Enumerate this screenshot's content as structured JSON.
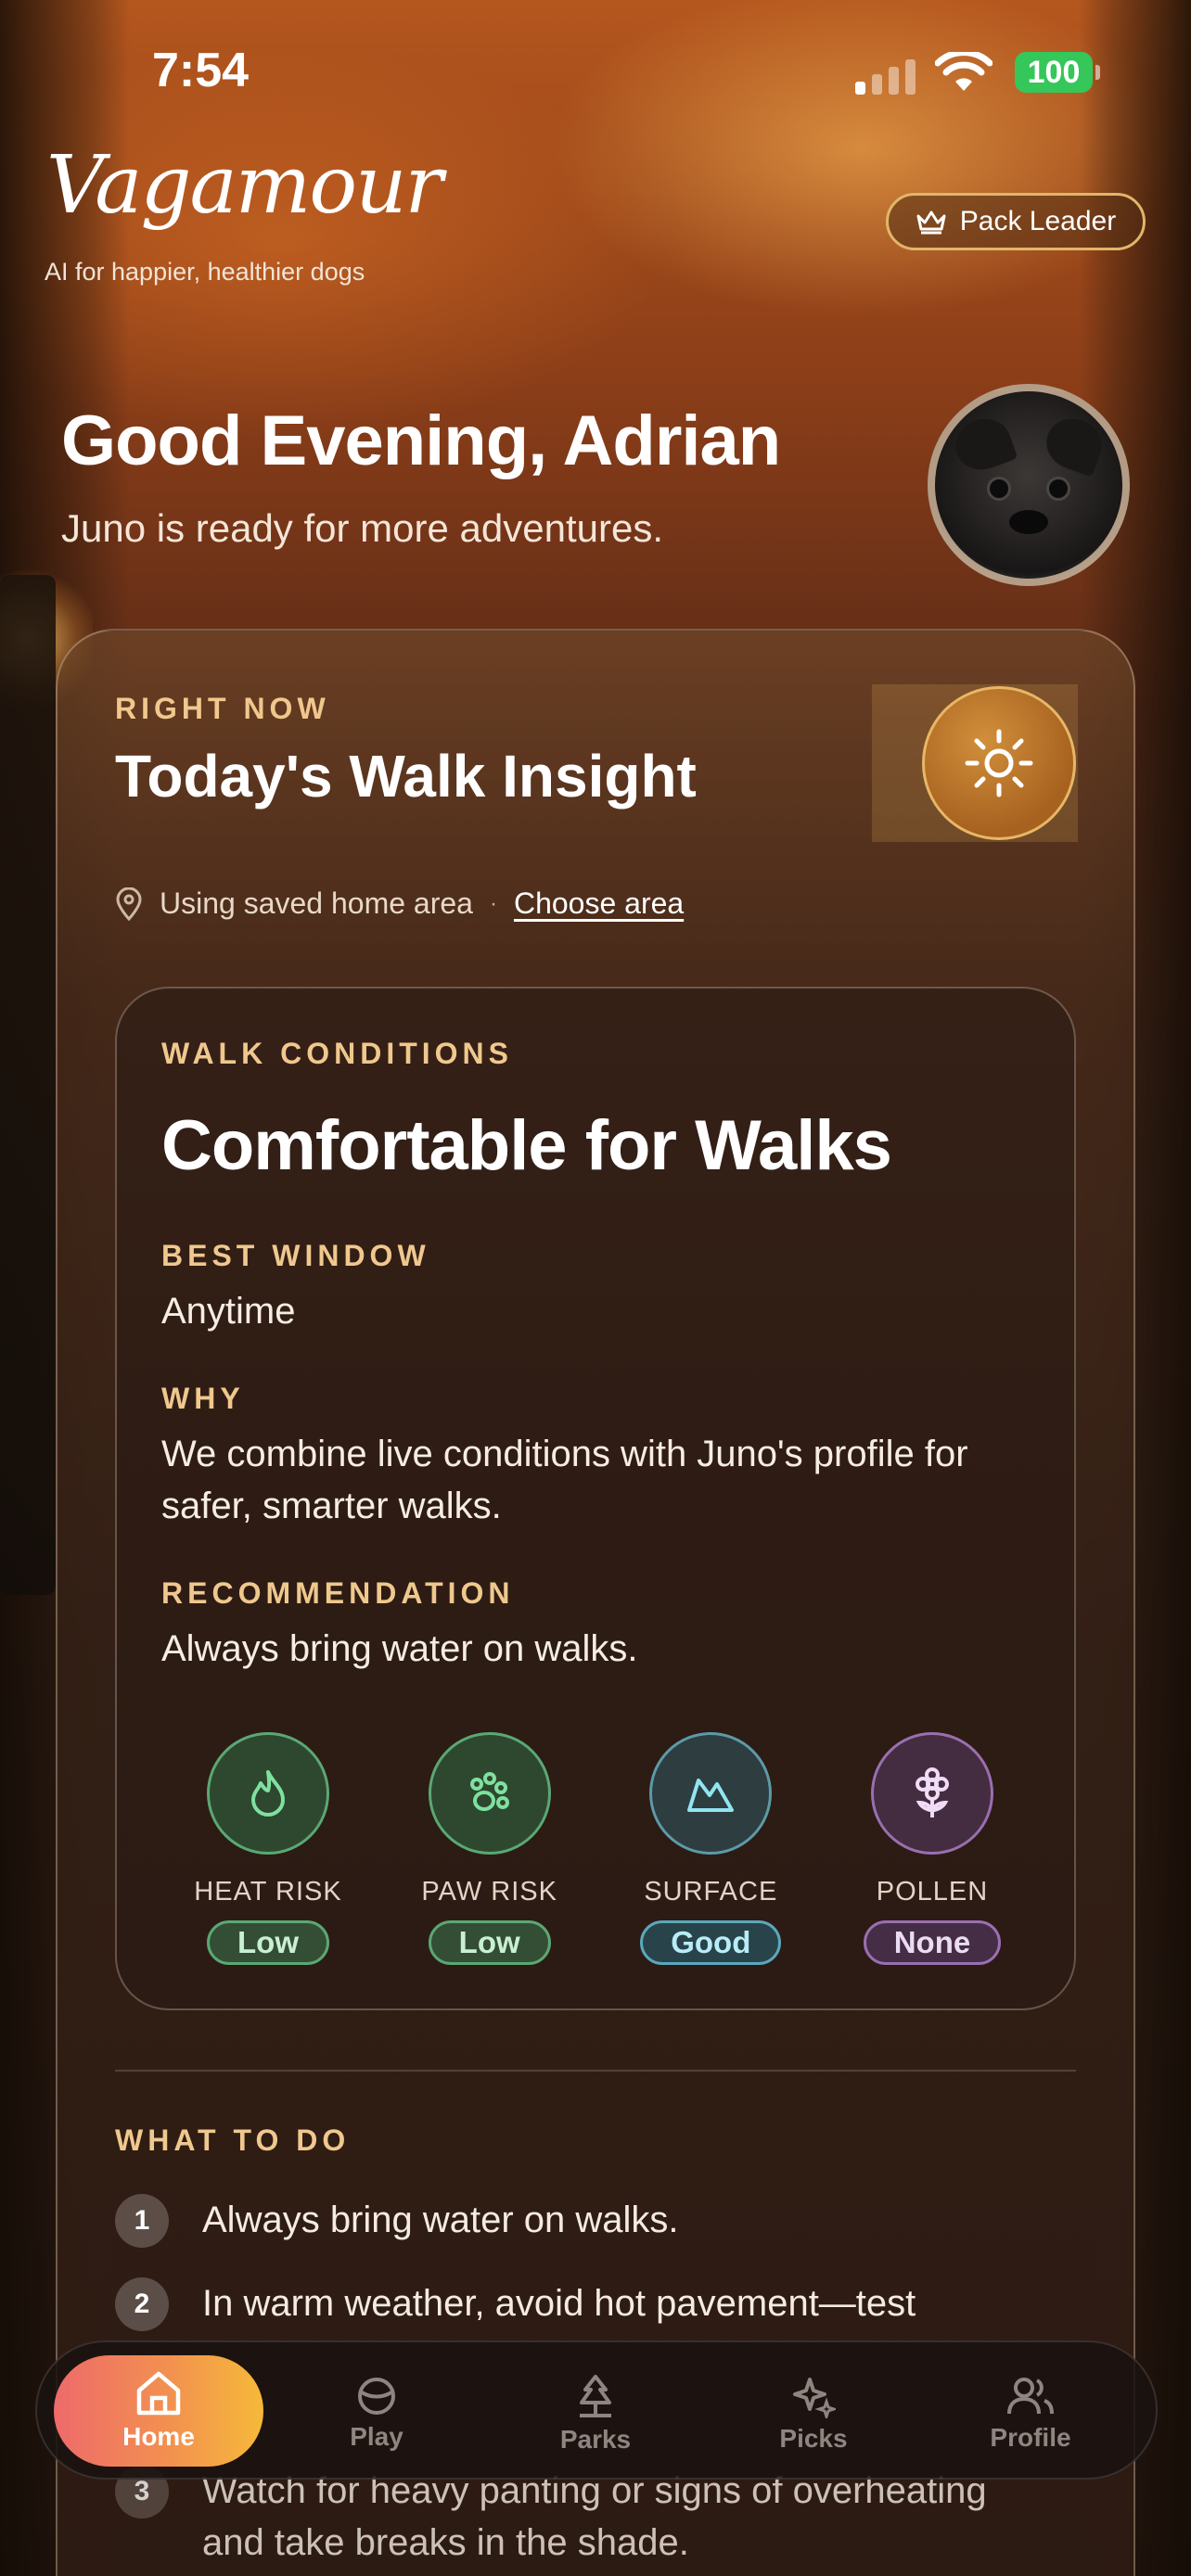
{
  "status_bar": {
    "time": "7:54",
    "battery": "100"
  },
  "header": {
    "logo": "Vagamour",
    "tagline": "AI for happier, healthier dogs",
    "badge": "Pack Leader",
    "greeting": "Good Evening, Adrian",
    "subgreeting": "Juno is ready for more adventures."
  },
  "insight": {
    "eyebrow": "RIGHT NOW",
    "title": "Today's Walk Insight",
    "location_text": "Using saved home area",
    "separator": "·",
    "choose_area": "Choose area"
  },
  "conditions": {
    "eyebrow": "WALK CONDITIONS",
    "title": "Comfortable for Walks",
    "best_window_label": "BEST WINDOW",
    "best_window": "Anytime",
    "why_label": "WHY",
    "why": "We combine live conditions with Juno's profile for safer, smarter walks.",
    "recommendation_label": "RECOMMENDATION",
    "recommendation": "Always bring water on walks.",
    "metrics": [
      {
        "label": "HEAT RISK",
        "value": "Low",
        "icon": "flame-icon"
      },
      {
        "label": "PAW RISK",
        "value": "Low",
        "icon": "paw-icon"
      },
      {
        "label": "SURFACE",
        "value": "Good",
        "icon": "terrain-icon"
      },
      {
        "label": "POLLEN",
        "value": "None",
        "icon": "flower-icon"
      }
    ]
  },
  "todo": {
    "eyebrow": "WHAT TO DO",
    "items": [
      {
        "num": "1",
        "text": "Always bring water on walks."
      },
      {
        "num": "2",
        "text": "In warm weather, avoid hot pavement—test"
      },
      {
        "num": "3",
        "text": "Watch for heavy panting or signs of overheating and take breaks in the shade."
      }
    ]
  },
  "tabs": [
    {
      "label": "Home",
      "icon": "home-icon",
      "active": true
    },
    {
      "label": "Play",
      "icon": "ball-icon"
    },
    {
      "label": "Parks",
      "icon": "tree-icon"
    },
    {
      "label": "Picks",
      "icon": "sparkle-icon"
    },
    {
      "label": "Profile",
      "icon": "people-icon"
    }
  ],
  "colors": {
    "accent_gold": "#f0c88e",
    "risk_low": "#5aa874",
    "surface_good": "#5aa8bc",
    "pollen_none": "#9a6fb0",
    "tab_active_start": "#ee6a6a",
    "tab_active_end": "#f6b93a"
  }
}
